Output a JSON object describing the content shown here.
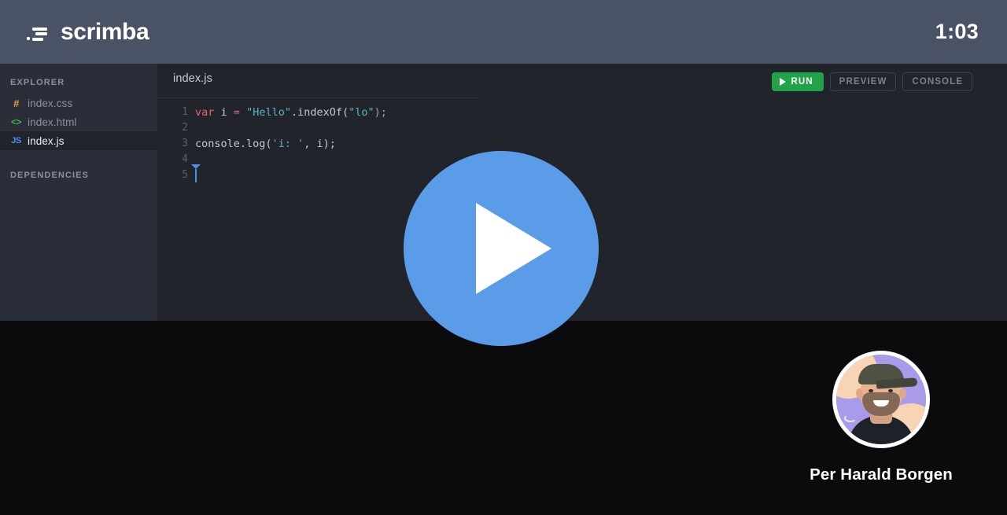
{
  "header": {
    "brand_name": "scrimba",
    "brand_icon": "scrimba-logo-icon",
    "timer": "1:03"
  },
  "sidebar": {
    "explorer_label": "EXPLORER",
    "dependencies_label": "DEPENDENCIES",
    "files": [
      {
        "name": "index.css",
        "icon": "#",
        "icon_name": "css-file-icon",
        "active": false
      },
      {
        "name": "index.html",
        "icon": "<>",
        "icon_name": "html-file-icon",
        "active": false
      },
      {
        "name": "index.js",
        "icon": "JS",
        "icon_name": "js-file-icon",
        "active": true
      }
    ]
  },
  "editor": {
    "tab_label": "index.js",
    "toolbar": {
      "run_label": "RUN",
      "preview_label": "PREVIEW",
      "console_label": "CONSOLE"
    },
    "code_lines": [
      {
        "number": "1",
        "tokens": [
          {
            "t": "var",
            "c": "tk-kw"
          },
          {
            "t": " i ",
            "c": "tk-pl"
          },
          {
            "t": "=",
            "c": "tk-op"
          },
          {
            "t": " ",
            "c": "tk-pl"
          },
          {
            "t": "\"Hello\"",
            "c": "tk-str"
          },
          {
            "t": ".indexOf(",
            "c": "tk-pl"
          },
          {
            "t": "\"lo\"",
            "c": "tk-str"
          },
          {
            "t": ");",
            "c": "tk-pun"
          }
        ]
      },
      {
        "number": "2",
        "tokens": []
      },
      {
        "number": "3",
        "tokens": [
          {
            "t": "console.log(",
            "c": "tk-pl"
          },
          {
            "t": "'i: '",
            "c": "tk-str"
          },
          {
            "t": ", i);",
            "c": "tk-pl"
          }
        ]
      },
      {
        "number": "4",
        "tokens": []
      },
      {
        "number": "5",
        "tokens": [],
        "cursor": true
      }
    ]
  },
  "overlay": {
    "play_button_name": "play-video-button"
  },
  "presenter": {
    "name": "Per Harald Borgen"
  },
  "colors": {
    "header_bg": "#4a5366",
    "sidebar_bg": "#2a2e38",
    "editor_bg": "#21242a",
    "page_bg": "#0b0b0d",
    "accent_blue": "#5a9ce8",
    "run_green": "#22a34a",
    "string_cyan": "#56b6c2",
    "keyword_red": "#e0696f",
    "js_icon_blue": "#4d8fe8",
    "html_icon_green": "#3fb950",
    "css_icon_orange": "#e8a33d"
  }
}
